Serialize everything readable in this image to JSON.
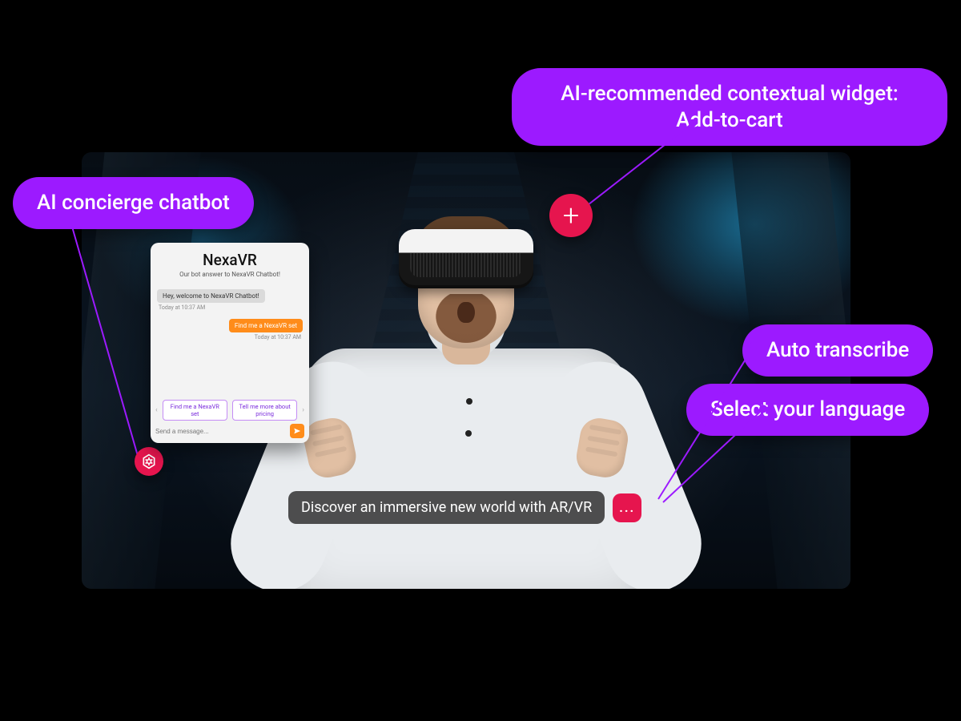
{
  "annotations": {
    "chatbot": "AI concierge chatbot",
    "widget_line1": "AI-recommended contextual widget:",
    "widget_line2": "Add-to-cart",
    "transcribe": "Auto transcribe",
    "language": "Select your language"
  },
  "chat": {
    "title": "NexaVR",
    "subtitle": "Our bot answer to NexaVR Chatbot!",
    "bot_msg": "Hey, welcome to NexaVR Chatbot!",
    "bot_ts": "Today at 10:37 AM",
    "user_msg": "Find me a NexaVR set",
    "user_ts": "Today at 10:37 AM",
    "suggest1": "Find me a NexaVR set",
    "suggest2": "Tell me more about pricing",
    "placeholder": "Send a message..."
  },
  "caption": "Discover an immersive new world with AR/VR",
  "more": "..."
}
